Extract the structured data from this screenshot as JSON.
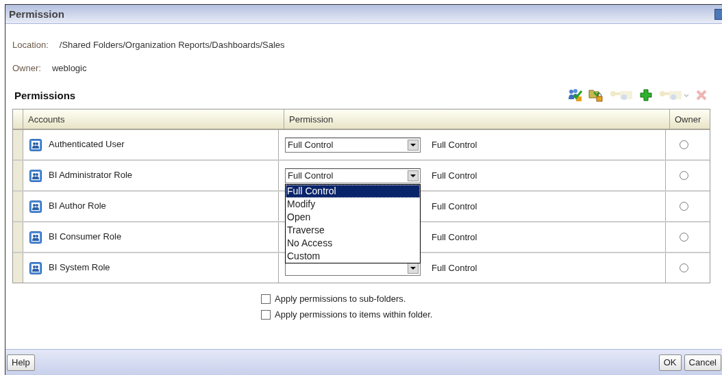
{
  "window": {
    "title": "Permission"
  },
  "location": {
    "label": "Location:",
    "value": "/Shared Folders/Organization Reports/Dashboards/Sales"
  },
  "owner": {
    "label": "Owner:",
    "value": "weblogic"
  },
  "section_title": "Permissions",
  "toolbar": [
    {
      "kind": "users-check",
      "disabled": false
    },
    {
      "kind": "folder-lock",
      "disabled": false
    },
    {
      "kind": "keys",
      "disabled": true
    },
    {
      "kind": "add",
      "disabled": false
    },
    {
      "kind": "keys-menu",
      "disabled": true
    },
    {
      "kind": "delete",
      "disabled": true
    }
  ],
  "table": {
    "columns": [
      "Accounts",
      "Permission",
      "Owner"
    ],
    "rows": [
      {
        "account": "Authenticated User",
        "select_value": "Full Control",
        "effective": "Full Control",
        "owner_selected": false
      },
      {
        "account": "BI Administrator Role",
        "select_value": "Full Control",
        "effective": "Full Control",
        "owner_selected": false
      },
      {
        "account": "BI Author Role",
        "effective": "Full Control",
        "owner_selected": false
      },
      {
        "account": "BI Consumer Role",
        "effective": "Full Control",
        "owner_selected": false
      },
      {
        "account": "BI System Role",
        "effective": "Full Control",
        "owner_selected": false
      }
    ]
  },
  "dropdown": {
    "options": [
      {
        "label": "Full Control",
        "selected": true
      },
      {
        "label": "Modify",
        "selected": false
      },
      {
        "label": "Open",
        "selected": false
      },
      {
        "label": "Traverse",
        "selected": false
      },
      {
        "label": "No Access",
        "selected": false
      },
      {
        "label": "Custom",
        "selected": false
      }
    ]
  },
  "options": [
    {
      "label": "Apply permissions to sub-folders.",
      "checked": false
    },
    {
      "label": "Apply permissions to items within folder.",
      "checked": false
    }
  ],
  "buttons": {
    "left": [
      "Help"
    ],
    "right": [
      "OK",
      "Cancel"
    ]
  }
}
